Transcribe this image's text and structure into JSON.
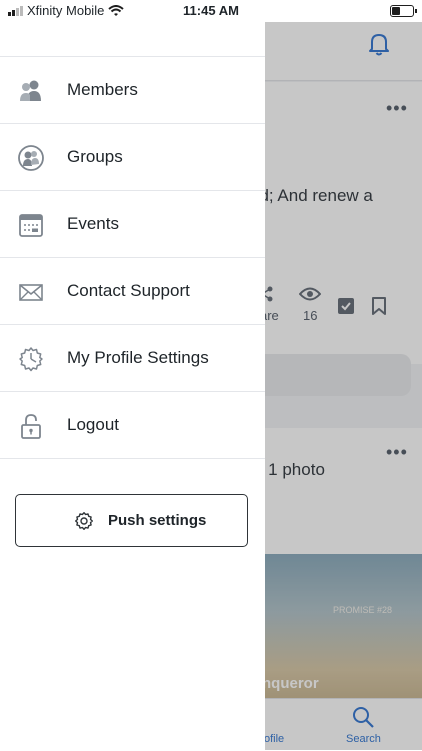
{
  "status_bar": {
    "carrier": "Xfinity Mobile",
    "time": "11:45 AM"
  },
  "drawer": {
    "items": [
      {
        "label": "Members",
        "icon": "members-icon"
      },
      {
        "label": "Groups",
        "icon": "groups-icon"
      },
      {
        "label": "Events",
        "icon": "calendar-icon"
      },
      {
        "label": "Contact Support",
        "icon": "envelope-icon"
      },
      {
        "label": "My Profile Settings",
        "icon": "profile-settings-icon"
      },
      {
        "label": "Logout",
        "icon": "unlock-icon"
      }
    ],
    "push_settings_label": "Push settings"
  },
  "background": {
    "post1_text": "od; And renew a",
    "share_label": "are",
    "views_count": "16",
    "post2_text": "d 1 photo",
    "photo_caption": "PROMISE #28",
    "photo_title": "nqueror",
    "tabs": {
      "profile_label": "ofile",
      "search_label": "Search"
    }
  },
  "colors": {
    "accent": "#3b7cd4",
    "overlay": "rgba(0,0,0,0.22)"
  }
}
